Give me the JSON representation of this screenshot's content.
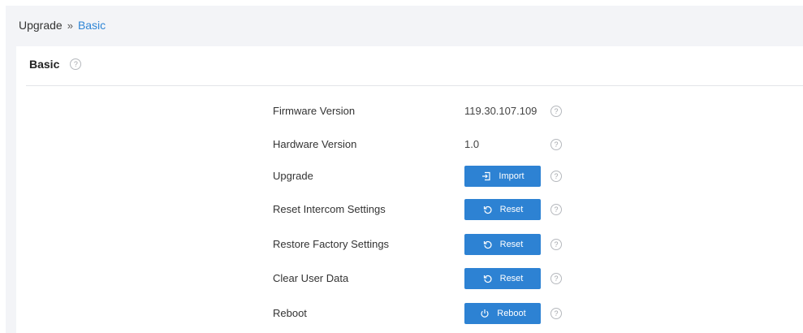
{
  "breadcrumb": {
    "parent": "Upgrade",
    "separator": "»",
    "current": "Basic"
  },
  "card": {
    "title": "Basic",
    "help_icon": "question-circle-icon"
  },
  "rows": [
    {
      "label": "Firmware Version",
      "value": "119.30.107.109"
    },
    {
      "label": "Hardware Version",
      "value": "1.0"
    },
    {
      "label": "Upgrade",
      "button": "Import",
      "icon": "import-icon"
    },
    {
      "label": "Reset Intercom Settings",
      "button": "Reset",
      "icon": "reset-icon"
    },
    {
      "label": "Restore Factory Settings",
      "button": "Reset",
      "icon": "reset-icon"
    },
    {
      "label": "Clear User Data",
      "button": "Reset",
      "icon": "reset-icon"
    },
    {
      "label": "Reboot",
      "button": "Reboot",
      "icon": "power-icon"
    }
  ],
  "colors": {
    "accent": "#2d82d3",
    "breadcrumb_link": "#2f86d6",
    "page_bg": "#f3f4f7"
  }
}
